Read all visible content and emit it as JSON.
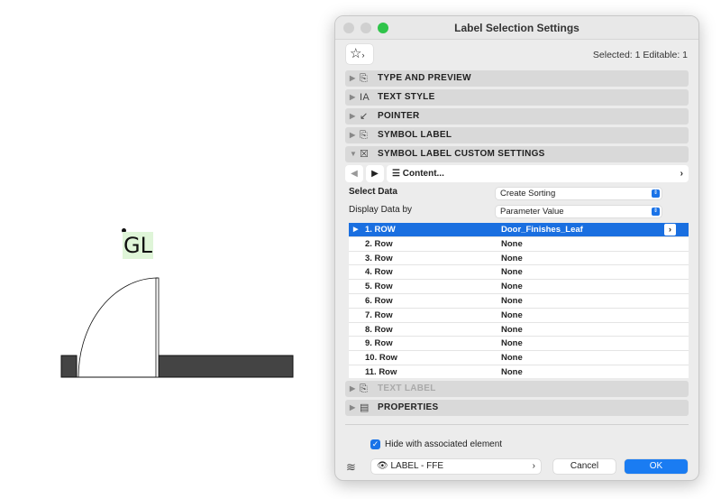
{
  "canvas": {
    "label_text": "GL"
  },
  "dialog": {
    "title": "Label Selection Settings",
    "selection_info": "Selected: 1 Editable: 1",
    "sections": [
      {
        "label": "TYPE AND PREVIEW",
        "icon": "type-preview-icon"
      },
      {
        "label": "TEXT STYLE",
        "icon": "text-style-icon"
      },
      {
        "label": "POINTER",
        "icon": "pointer-icon"
      },
      {
        "label": "SYMBOL LABEL",
        "icon": "symbol-label-icon"
      },
      {
        "label": "SYMBOL LABEL CUSTOM SETTINGS",
        "icon": "custom-settings-icon"
      }
    ],
    "content_page": "Content...",
    "select_data": {
      "label": "Select Data",
      "value": "Create Sorting"
    },
    "display_data_by": {
      "label": "Display Data by",
      "value": "Parameter Value"
    },
    "rows": [
      {
        "key": "1. ROW",
        "value": "Door_Finishes_Leaf"
      },
      {
        "key": "2. Row",
        "value": "None"
      },
      {
        "key": "3. Row",
        "value": "None"
      },
      {
        "key": "4. Row",
        "value": "None"
      },
      {
        "key": "5. Row",
        "value": "None"
      },
      {
        "key": "6. Row",
        "value": "None"
      },
      {
        "key": "7. Row",
        "value": "None"
      },
      {
        "key": "8. Row",
        "value": "None"
      },
      {
        "key": "9. Row",
        "value": "None"
      },
      {
        "key": "10. Row",
        "value": "None"
      },
      {
        "key": "11. Row",
        "value": "None"
      }
    ],
    "text_label": "TEXT LABEL",
    "properties": "PROPERTIES",
    "hide_checkbox": {
      "label": "Hide with associated element",
      "checked": true
    },
    "layer": "LABEL - FFE",
    "cancel": "Cancel",
    "ok": "OK"
  }
}
